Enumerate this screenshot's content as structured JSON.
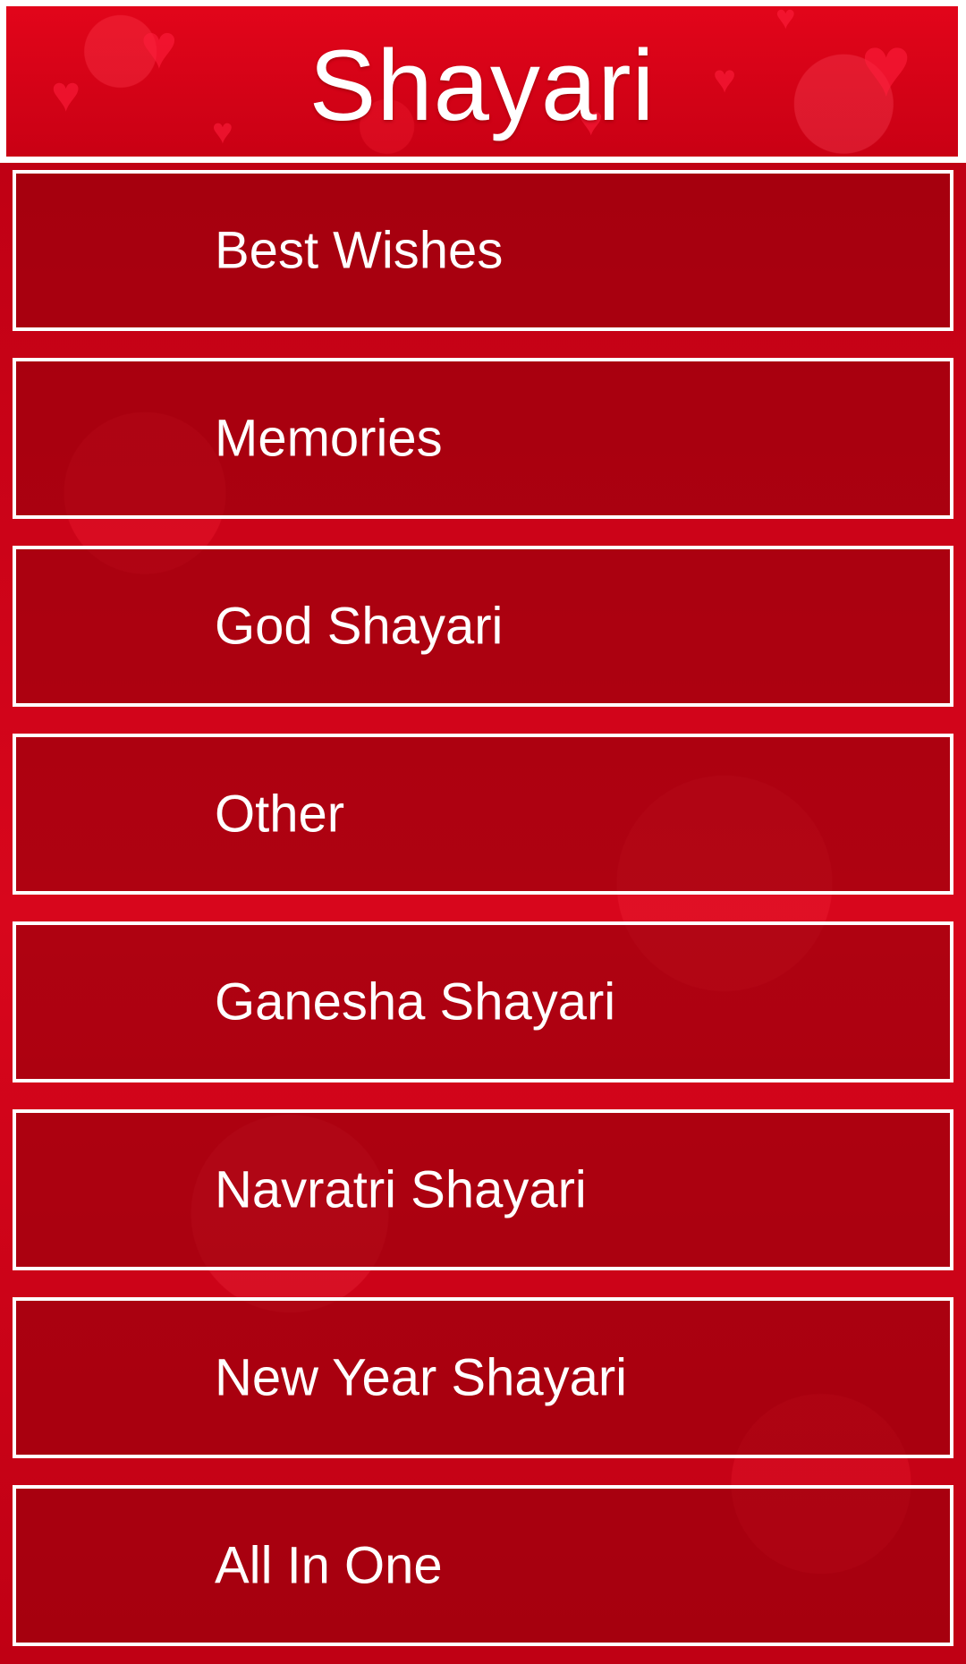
{
  "header": {
    "title": "Shayari"
  },
  "menu": {
    "items": [
      {
        "label": "Best Wishes"
      },
      {
        "label": "Memories"
      },
      {
        "label": "God Shayari"
      },
      {
        "label": "Other"
      },
      {
        "label": "Ganesha Shayari"
      },
      {
        "label": "Navratri Shayari"
      },
      {
        "label": "New Year Shayari"
      },
      {
        "label": "All In One"
      }
    ]
  },
  "colors": {
    "background_red": "#c90014",
    "item_fill": "#96000c",
    "border": "#ffffff",
    "text": "#ffffff"
  }
}
